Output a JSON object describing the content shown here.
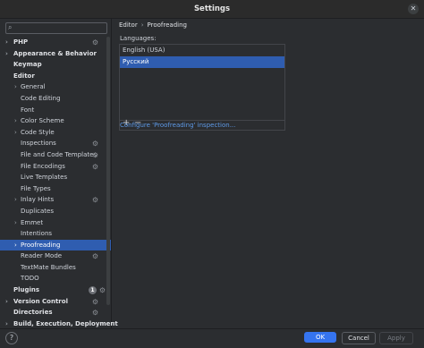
{
  "window": {
    "title": "Settings"
  },
  "search": {
    "placeholder": ""
  },
  "sidebar": {
    "items": [
      {
        "label": "PHP",
        "level": 0,
        "chevron": true,
        "gear": true
      },
      {
        "label": "Appearance & Behavior",
        "level": 0,
        "chevron": true
      },
      {
        "label": "Keymap",
        "level": 0
      },
      {
        "label": "Editor",
        "level": 0,
        "expanded": true
      },
      {
        "label": "General",
        "level": 1,
        "chevron": true
      },
      {
        "label": "Code Editing",
        "level": 1
      },
      {
        "label": "Font",
        "level": 1
      },
      {
        "label": "Color Scheme",
        "level": 1,
        "chevron": true
      },
      {
        "label": "Code Style",
        "level": 1,
        "chevron": true
      },
      {
        "label": "Inspections",
        "level": 1,
        "gear": true
      },
      {
        "label": "File and Code Templates",
        "level": 1,
        "gear": true
      },
      {
        "label": "File Encodings",
        "level": 1,
        "gear": true
      },
      {
        "label": "Live Templates",
        "level": 1
      },
      {
        "label": "File Types",
        "level": 1
      },
      {
        "label": "Inlay Hints",
        "level": 1,
        "chevron": true,
        "gear": true
      },
      {
        "label": "Duplicates",
        "level": 1
      },
      {
        "label": "Emmet",
        "level": 1,
        "chevron": true
      },
      {
        "label": "Intentions",
        "level": 1
      },
      {
        "label": "Proofreading",
        "level": 1,
        "chevron": true,
        "selected": true
      },
      {
        "label": "Reader Mode",
        "level": 1,
        "gear": true
      },
      {
        "label": "TextMate Bundles",
        "level": 1
      },
      {
        "label": "TODO",
        "level": 1
      },
      {
        "label": "Plugins",
        "level": 0,
        "badge": "1",
        "gear": true
      },
      {
        "label": "Version Control",
        "level": 0,
        "chevron": true,
        "gear": true
      },
      {
        "label": "Directories",
        "level": 0,
        "gear": true
      },
      {
        "label": "Build, Execution, Deployment",
        "level": 0,
        "chevron": true
      }
    ]
  },
  "content": {
    "breadcrumb": [
      "Editor",
      "Proofreading"
    ],
    "languages_label": "Languages:",
    "languages": [
      {
        "label": "English (USA)",
        "selected": false
      },
      {
        "label": "Русский",
        "selected": true
      }
    ],
    "add_label": "+",
    "remove_label": "−",
    "inspection_link": "Configure 'Proofreading' inspection..."
  },
  "footer": {
    "help_label": "?",
    "ok_label": "OK",
    "cancel_label": "Cancel",
    "apply_label": "Apply"
  },
  "colors": {
    "accent": "#3574f0",
    "selection": "#2f5db0",
    "link": "#5e9ae8"
  }
}
